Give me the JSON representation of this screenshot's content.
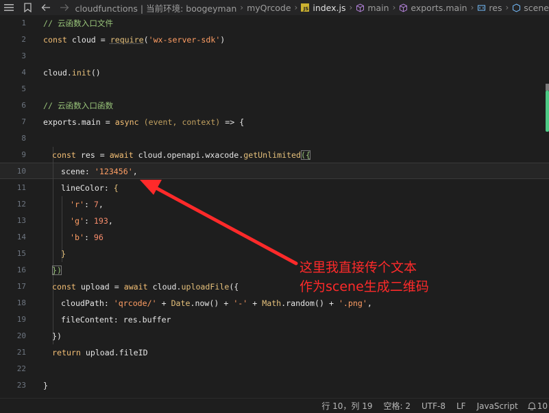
{
  "breadcrumb": {
    "path_prefix": "cloudfunctions | 当前环境: boogeyman",
    "folder": "myQrcode",
    "file": "index.js",
    "file_badge": "JS",
    "symbols": [
      "main",
      "exports.main",
      "res",
      "scene"
    ]
  },
  "editor": {
    "line_numbers": [
      "1",
      "2",
      "3",
      "4",
      "5",
      "6",
      "7",
      "8",
      "9",
      "10",
      "11",
      "12",
      "13",
      "14",
      "15",
      "16",
      "17",
      "18",
      "19",
      "20",
      "21",
      "22",
      "23"
    ],
    "code": {
      "l1_comment": "// 云函数入口文件",
      "l2_const": "const",
      "l2_name": " cloud = ",
      "l2_require": "require",
      "l2_open": "(",
      "l2_str": "'wx-server-sdk'",
      "l2_close": ")",
      "l4_cloud": "cloud.",
      "l4_init": "init",
      "l4_paren": "()",
      "l6_comment": "// 云函数入口函数",
      "l7_exports": "exports.main",
      "l7_eq": " = ",
      "l7_async": "async",
      "l7_params": " (event, context)",
      "l7_arrow": " => ",
      "l7_brace": "{",
      "l9_const": "const",
      "l9_res": " res = ",
      "l9_await": "await",
      "l9_call": " cloud.openapi.wxacode.",
      "l9_fn": "getUnlimited",
      "l9_open": "({",
      "l10_key": "scene: ",
      "l10_val": "'123456'",
      "l10_comma": ",",
      "l11_key": "lineColor: ",
      "l11_brace": "{",
      "l12_key": "'r'",
      "l12_colon": ": ",
      "l12_val": "7",
      "l12_comma": ",",
      "l13_key": "'g'",
      "l13_colon": ": ",
      "l13_val": "193",
      "l13_comma": ",",
      "l14_key": "'b'",
      "l14_colon": ": ",
      "l14_val": "96",
      "l15_brace": "}",
      "l16_close": "})",
      "l17_const": "const",
      "l17_upload": " upload = ",
      "l17_await": "await",
      "l17_call": " cloud.",
      "l17_fn": "uploadFile",
      "l17_open": "({",
      "l18_key": "cloudPath: ",
      "l18_str1": "'qrcode/'",
      "l18_plus1": " + ",
      "l18_date": "Date",
      "l18_now": ".now",
      "l18_p1": "()",
      "l18_plus2": " + ",
      "l18_dash": "'-'",
      "l18_plus3": " + ",
      "l18_math": "Math",
      "l18_random": ".random",
      "l18_p2": "()",
      "l18_plus4": " + ",
      "l18_png": "'.png'",
      "l18_comma": ",",
      "l19_text": "fileContent: res.buffer",
      "l20_close": "})",
      "l21_return": "return",
      "l21_rest": " upload.fileID",
      "l23_close": "}"
    }
  },
  "annotation": {
    "line1": "这里我直接传个文本",
    "line2": "作为scene生成二维码",
    "color": "#ff2a2a"
  },
  "statusbar": {
    "position": "行 10，列 19",
    "spaces": "空格: 2",
    "encoding": "UTF-8",
    "eol": "LF",
    "language": "JavaScript",
    "notifications": "10"
  }
}
